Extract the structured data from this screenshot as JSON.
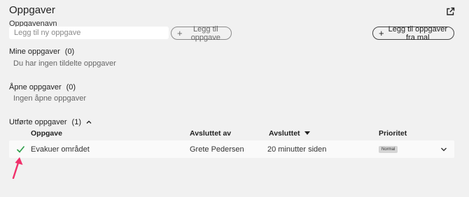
{
  "header": {
    "title": "Oppgaver",
    "external_icon": "external-link-icon"
  },
  "new_task": {
    "label": "Oppgavenavn",
    "placeholder": "Legg til ny oppgave",
    "value": "",
    "add_button": "Legg til oppgave",
    "template_button": "Legg til oppgaver fra mal"
  },
  "my_tasks": {
    "title": "Mine oppgaver",
    "count": "(0)",
    "empty": "Du har ingen tildelte oppgaver"
  },
  "open_tasks": {
    "title": "Åpne oppgaver",
    "count": "(0)",
    "empty": "Ingen åpne oppgaver"
  },
  "completed": {
    "title": "Utførte oppgaver",
    "count": "(1)",
    "expanded": true,
    "columns": {
      "task": "Oppgave",
      "completed_by": "Avsluttet av",
      "completed": "Avsluttet",
      "priority": "Prioritet"
    },
    "sort_column": "completed",
    "rows": [
      {
        "task": "Evakuer området",
        "completed_by": "Grete Pedersen",
        "completed": "20 minutter siden",
        "priority": "Normal",
        "status_icon": "check-icon"
      }
    ]
  },
  "colors": {
    "check": "#2e9e4a",
    "annotation_arrow": "#f0306a",
    "background": "#f1f1f1"
  }
}
